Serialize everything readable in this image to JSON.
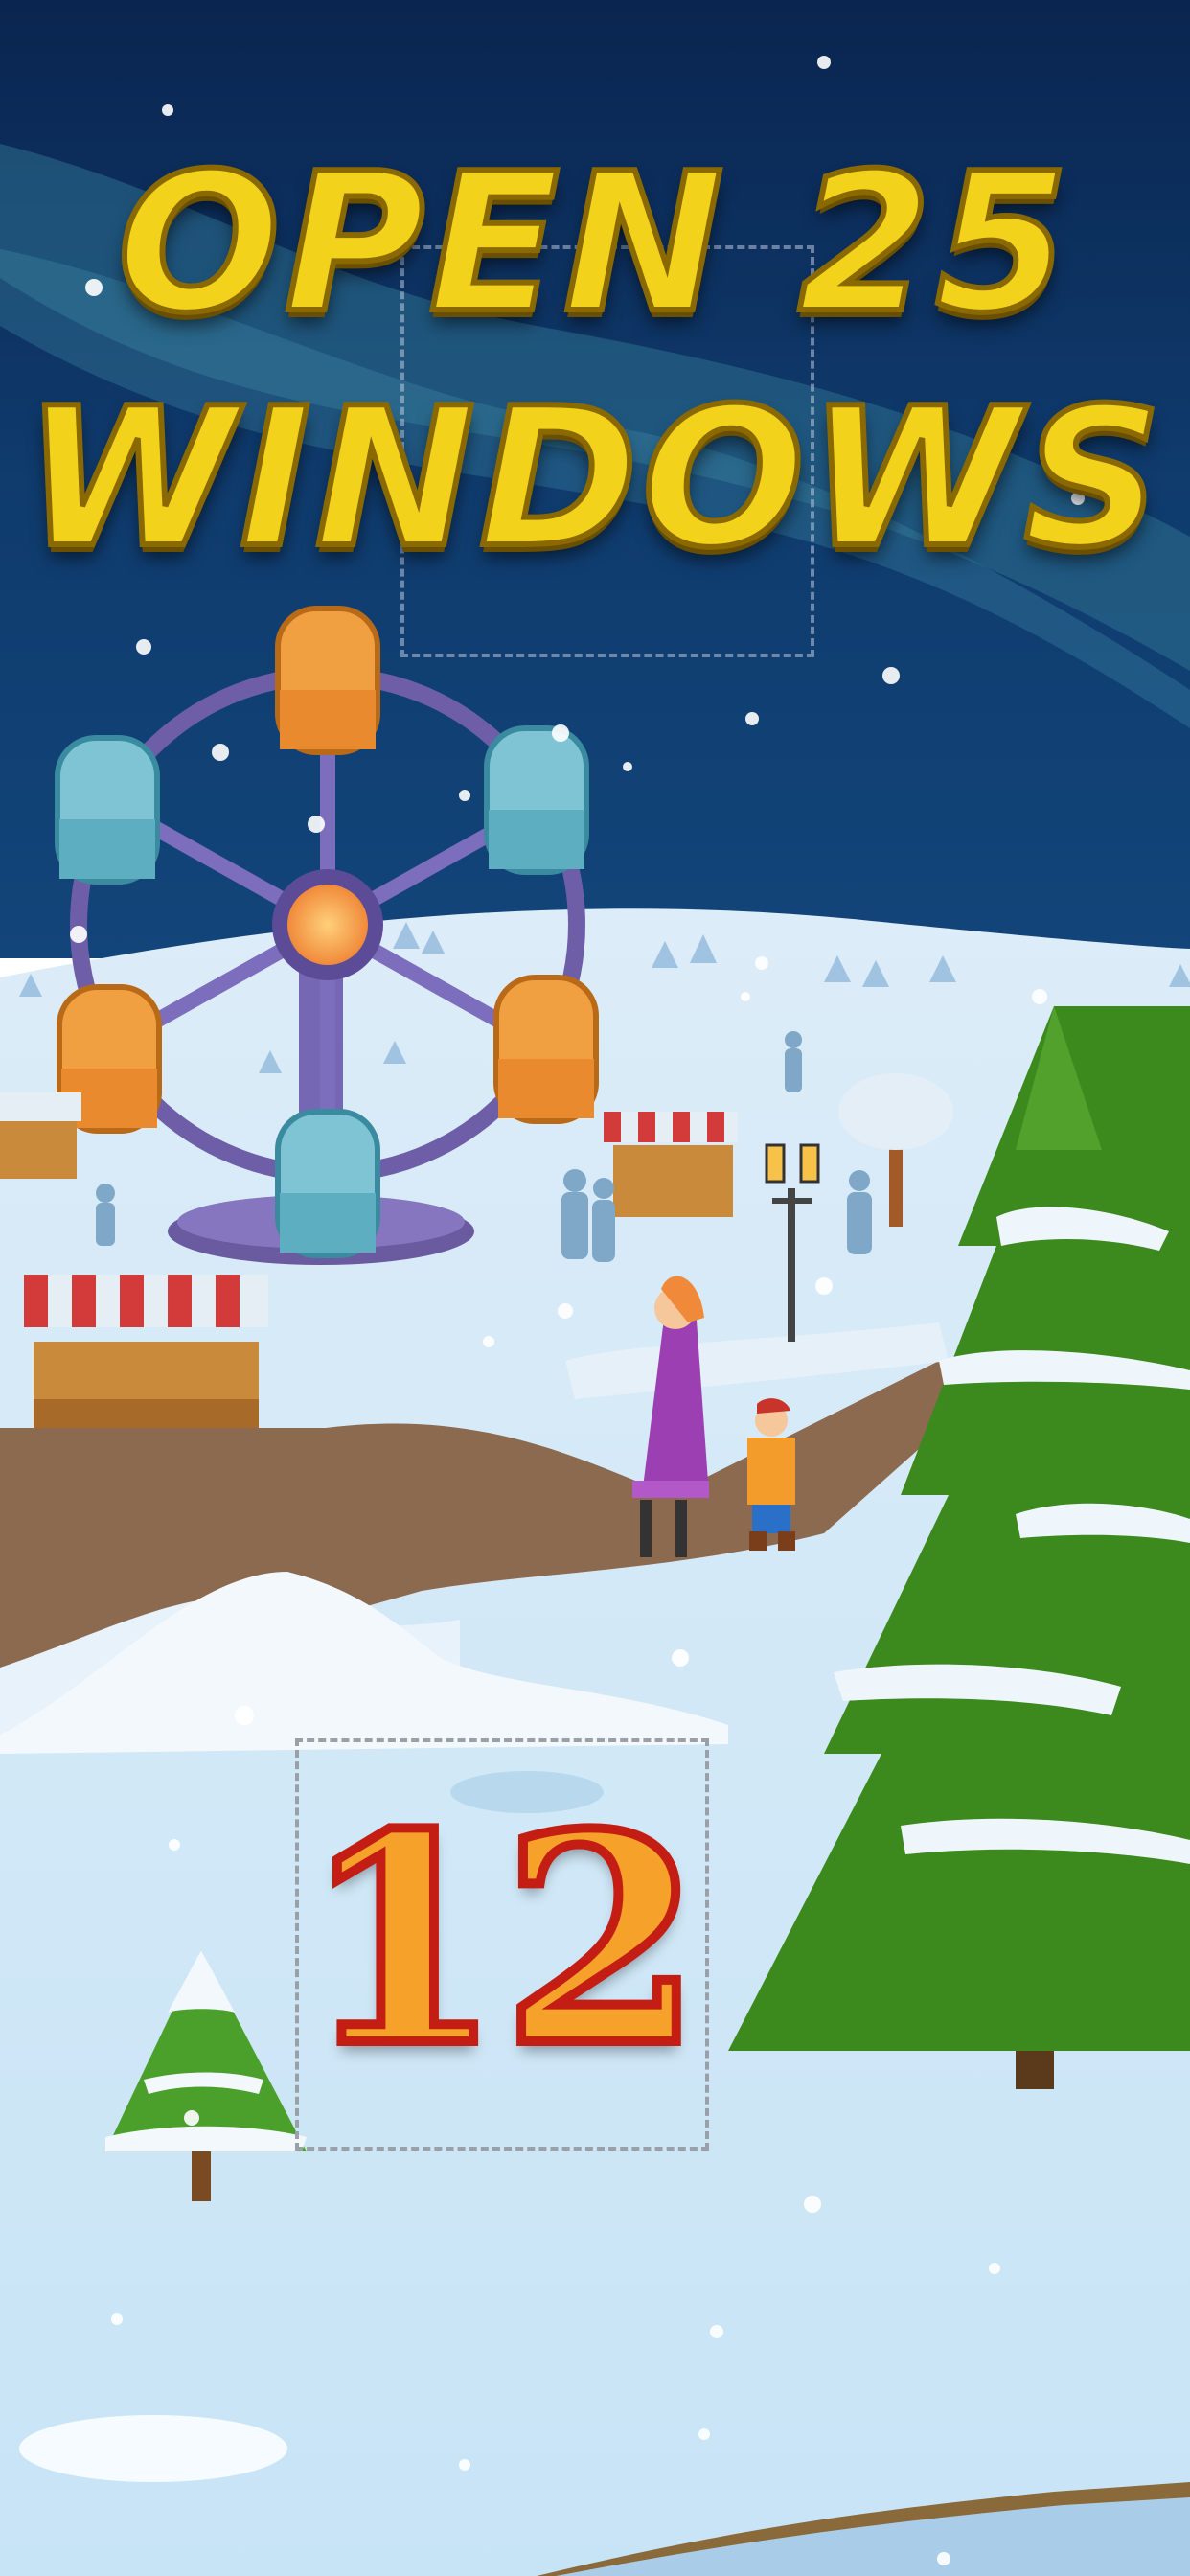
{
  "headline": {
    "line1": "OPEN 25",
    "line2": "WINDOWS"
  },
  "calendar": {
    "current_day": "12"
  },
  "colors": {
    "sky_top": "#0b2a55",
    "sky_bottom": "#0e3a6b",
    "aurora": "#2f6f8c",
    "snow": "#dbeefa",
    "snow_shadow": "#b8d8ee",
    "boardwalk": "#8b6a4f",
    "tree_green": "#3c8a1e",
    "headline_gold": "#f3d21c",
    "number_orange": "#f5a12a",
    "number_outline": "#c41e14"
  }
}
